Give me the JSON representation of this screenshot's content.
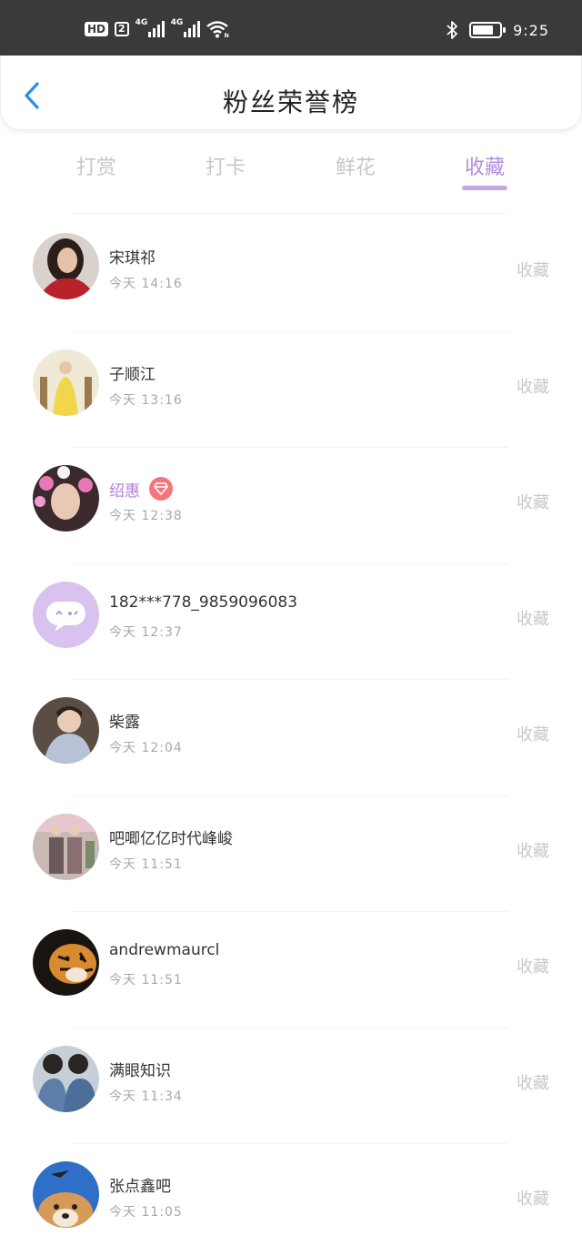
{
  "status_bar": {
    "hd": "HD",
    "sim": "2",
    "net1": "4G",
    "net2": "4G",
    "battery_level": 0.78,
    "time": "9:25"
  },
  "header": {
    "title": "粉丝荣誉榜",
    "back_icon": "chevron-left-icon"
  },
  "tabs": [
    {
      "label": "打赏",
      "active": false
    },
    {
      "label": "打卡",
      "active": false
    },
    {
      "label": "鲜花",
      "active": false
    },
    {
      "label": "收藏",
      "active": true
    }
  ],
  "colors": {
    "accent": "#b28ee0",
    "vip_name": "#b07fd6",
    "badge": "#f4767a"
  },
  "fans": [
    {
      "name": "宋琪祁",
      "time": "今天 14:16",
      "action": "收藏",
      "vip": false
    },
    {
      "name": "子顺江",
      "time": "今天 13:16",
      "action": "收藏",
      "vip": false
    },
    {
      "name": "绍惠",
      "time": "今天 12:38",
      "action": "收藏",
      "vip": true
    },
    {
      "name": "182***778_9859096083",
      "time": "今天 12:37",
      "action": "收藏",
      "vip": false
    },
    {
      "name": "柴露",
      "time": "今天 12:04",
      "action": "收藏",
      "vip": false
    },
    {
      "name": "吧唧亿亿时代峰峻",
      "time": "今天 11:51",
      "action": "收藏",
      "vip": false
    },
    {
      "name": "andrewmaurcl",
      "time": "今天 11:51",
      "action": "收藏",
      "vip": false
    },
    {
      "name": "满眼知识",
      "time": "今天 11:34",
      "action": "收藏",
      "vip": false
    },
    {
      "name": "张点鑫吧",
      "time": "今天 11:05",
      "action": "收藏",
      "vip": false
    }
  ]
}
